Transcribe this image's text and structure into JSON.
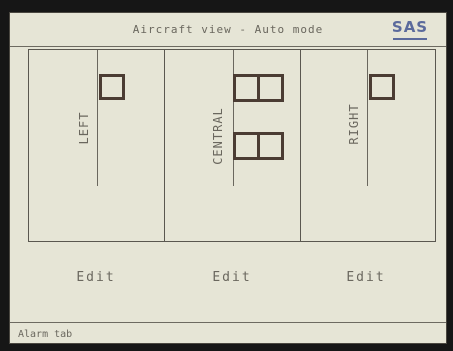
{
  "header": {
    "title": "Aircraft view - Auto mode",
    "logo_text": "SAS",
    "logo_color": "#5b6a9c"
  },
  "panels": [
    {
      "label": "LEFT",
      "edit_label": "Edit",
      "slots": 1
    },
    {
      "label": "CENTRAL",
      "edit_label": "Edit",
      "slots": 2
    },
    {
      "label": "RIGHT",
      "edit_label": "Edit",
      "slots": 1
    }
  ],
  "footer": {
    "alarm_tab_label": "Alarm tab"
  },
  "colors": {
    "screen_bg": "#e6e5d6",
    "line": "#5a5750",
    "slot_border": "#4b3c33"
  }
}
